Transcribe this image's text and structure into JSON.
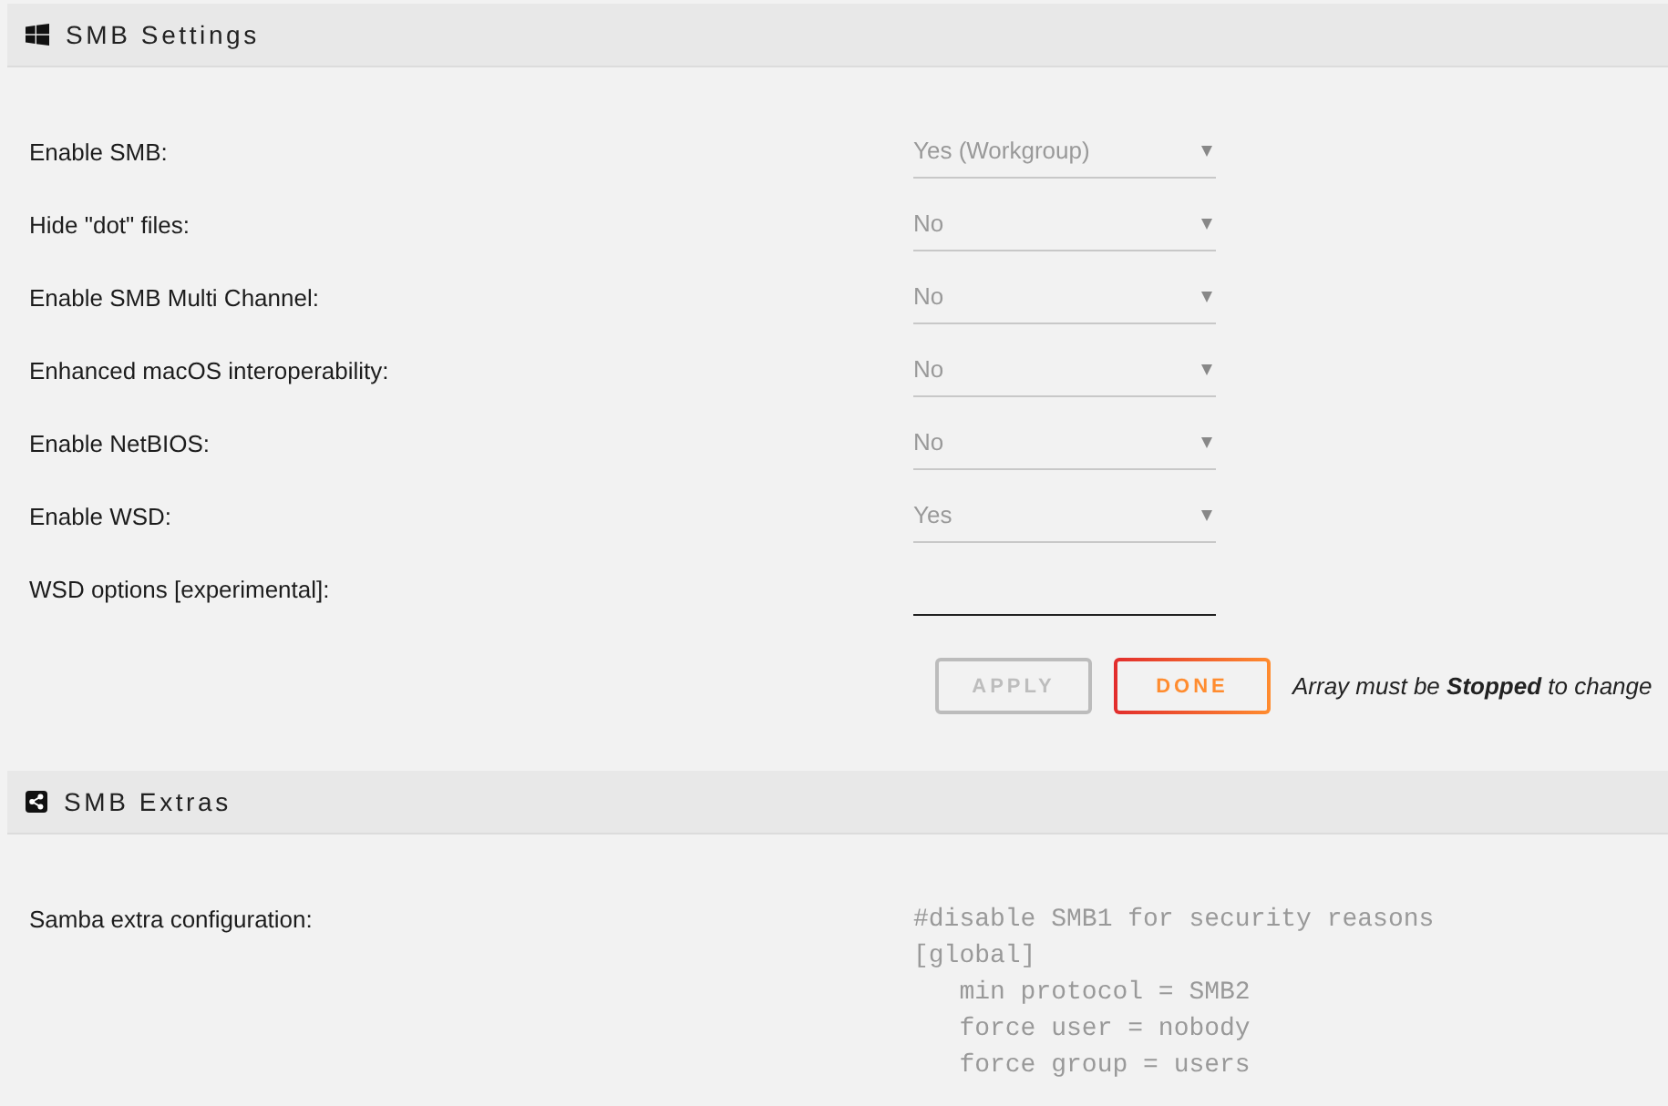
{
  "sections": [
    {
      "title": "SMB Settings",
      "fields": [
        {
          "label": "Enable SMB:",
          "kind": "select",
          "value": "Yes (Workgroup)",
          "disabled": true
        },
        {
          "label": "Hide \"dot\" files:",
          "kind": "select",
          "value": "No",
          "disabled": true
        },
        {
          "label": "Enable SMB Multi Channel:",
          "kind": "select",
          "value": "No",
          "disabled": true
        },
        {
          "label": "Enhanced macOS interoperability:",
          "kind": "select",
          "value": "No",
          "disabled": true
        },
        {
          "label": "Enable NetBIOS:",
          "kind": "select",
          "value": "No",
          "disabled": true
        },
        {
          "label": "Enable WSD:",
          "kind": "select",
          "value": "Yes",
          "disabled": true
        },
        {
          "label": "WSD options [experimental]:",
          "kind": "text",
          "disabled": false
        }
      ],
      "buttons": [
        {
          "label": "APPLY",
          "disabled": true
        },
        {
          "label": "DONE",
          "disabled": false
        }
      ],
      "note": "Array must be **Stopped** to change"
    },
    {
      "title": "SMB Extras",
      "fields": [
        {
          "label": "Samba extra configuration:",
          "kind": "textarea",
          "value": "#disable SMB1 for security reasons\n[global]\n   min protocol = SMB2\n   force user = nobody\n   force group = users",
          "disabled": true
        }
      ]
    }
  ]
}
